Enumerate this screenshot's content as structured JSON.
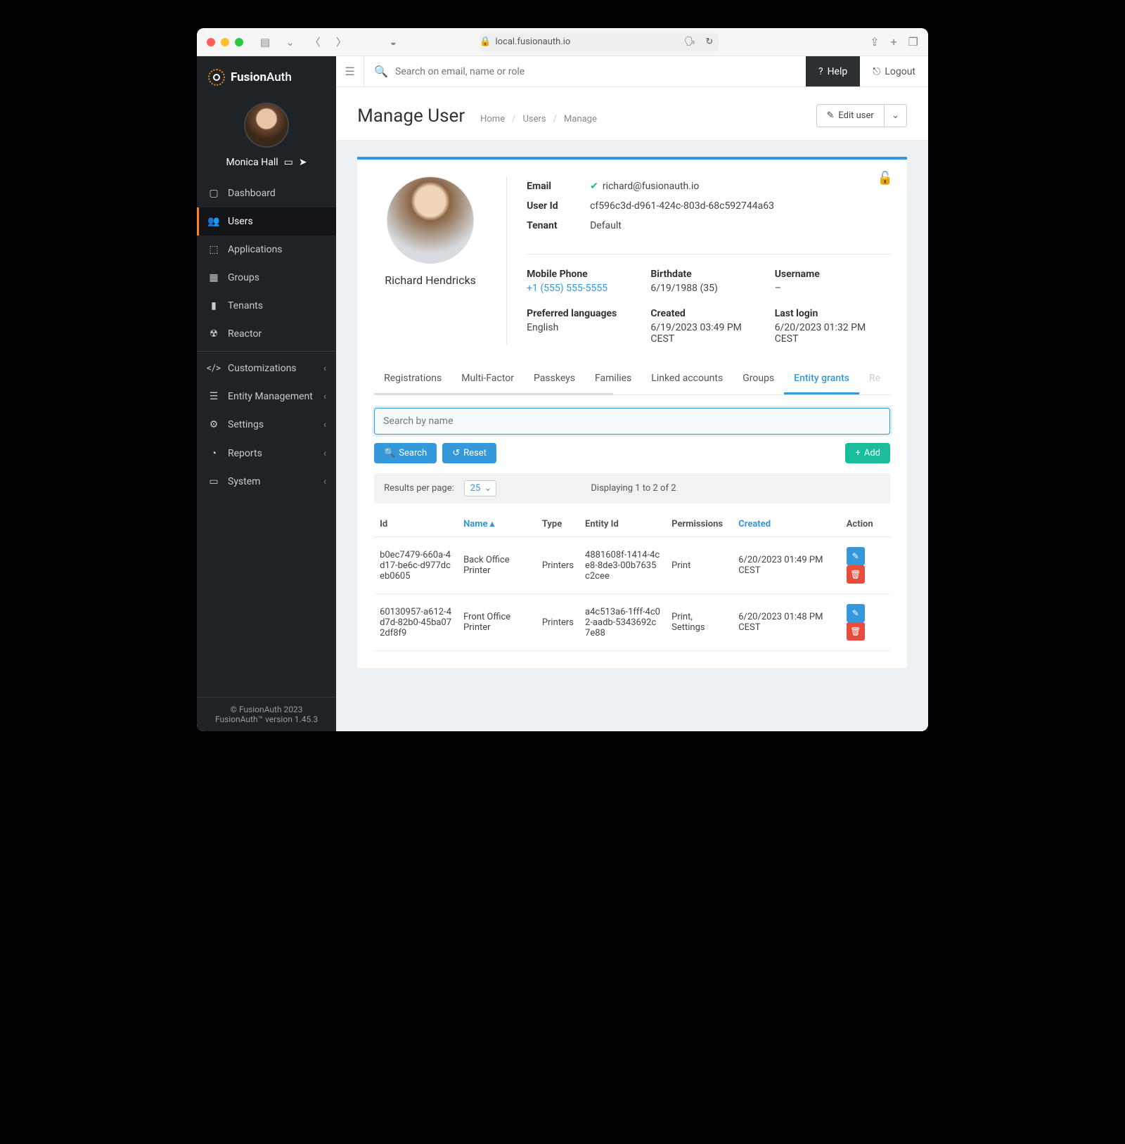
{
  "browser": {
    "url": "local.fusionauth.io"
  },
  "brand": {
    "name_a": "Fusion",
    "name_b": "Auth"
  },
  "current_user": {
    "name": "Monica Hall"
  },
  "sidebar": {
    "items": [
      {
        "label": "Dashboard"
      },
      {
        "label": "Users"
      },
      {
        "label": "Applications"
      },
      {
        "label": "Groups"
      },
      {
        "label": "Tenants"
      },
      {
        "label": "Reactor"
      },
      {
        "label": "Customizations"
      },
      {
        "label": "Entity Management"
      },
      {
        "label": "Settings"
      },
      {
        "label": "Reports"
      },
      {
        "label": "System"
      }
    ]
  },
  "footer": {
    "copyright": "© FusionAuth 2023",
    "version": "FusionAuth™ version 1.45.3"
  },
  "topbar": {
    "search_placeholder": "Search on email, name or role",
    "help": "Help",
    "logout": "Logout"
  },
  "page": {
    "title": "Manage User",
    "breadcrumb": {
      "a": "Home",
      "b": "Users",
      "c": "Manage"
    },
    "edit_button": "Edit user"
  },
  "user": {
    "name": "Richard Hendricks",
    "labels": {
      "email": "Email",
      "user_id": "User Id",
      "tenant": "Tenant",
      "mobile": "Mobile Phone",
      "birthdate": "Birthdate",
      "username": "Username",
      "languages": "Preferred languages",
      "created": "Created",
      "last_login": "Last login"
    },
    "email": "richard@fusionauth.io",
    "user_id": "cf596c3d-d961-424c-803d-68c592744a63",
    "tenant": "Default",
    "mobile": "+1 (555) 555-5555",
    "birthdate": "6/19/1988 (35)",
    "username": "–",
    "languages": "English",
    "created": "6/19/2023 03:49 PM CEST",
    "last_login": "6/20/2023 01:32 PM CEST"
  },
  "tabs": {
    "t0": "Registrations",
    "t1": "Multi-Factor",
    "t2": "Passkeys",
    "t3": "Families",
    "t4": "Linked accounts",
    "t5": "Groups",
    "t6": "Entity grants",
    "t7": "Re"
  },
  "grants": {
    "search_placeholder": "Search by name",
    "search_btn": "Search",
    "reset_btn": "Reset",
    "add_btn": "Add",
    "rpp_label": "Results per page:",
    "rpp_value": "25",
    "displaying": "Displaying 1 to 2 of 2",
    "headers": {
      "id": "Id",
      "name": "Name",
      "type": "Type",
      "entity_id": "Entity Id",
      "permissions": "Permissions",
      "created": "Created",
      "action": "Action"
    },
    "rows": [
      {
        "id": "b0ec7479-660a-4d17-be6c-d977dceb0605",
        "name": "Back Office Printer",
        "type": "Printers",
        "entity_id": "4881608f-1414-4ce8-8de3-00b7635c2cee",
        "permissions": "Print",
        "created": "6/20/2023 01:49 PM CEST"
      },
      {
        "id": "60130957-a612-4d7d-82b0-45ba072df8f9",
        "name": "Front Office Printer",
        "type": "Printers",
        "entity_id": "a4c513a6-1fff-4c02-aadb-5343692c7e88",
        "permissions": "Print, Settings",
        "created": "6/20/2023 01:48 PM CEST"
      }
    ]
  }
}
